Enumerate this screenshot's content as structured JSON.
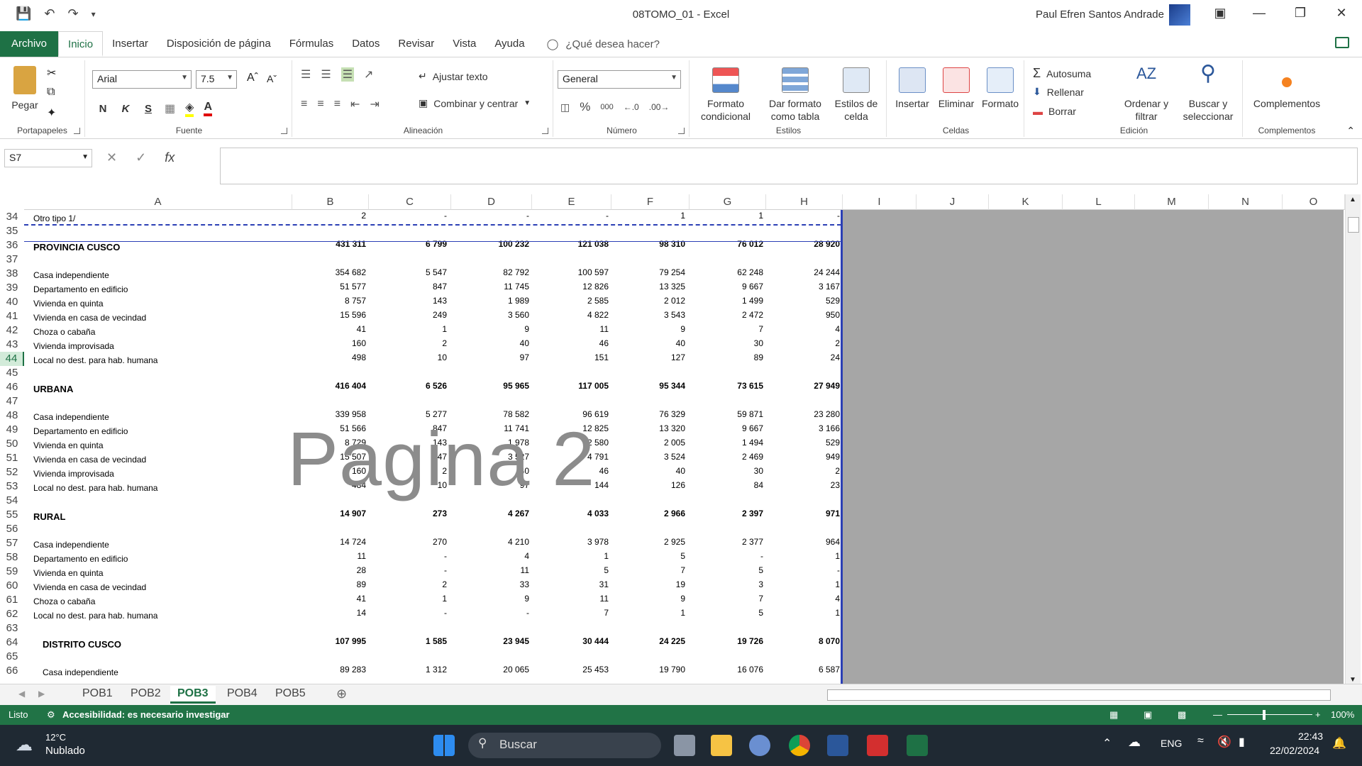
{
  "titlebar": {
    "title": "08TOMO_01  -  Excel",
    "user": "Paul Efren Santos Andrade"
  },
  "tabs": [
    "Archivo",
    "Inicio",
    "Insertar",
    "Disposición de página",
    "Fórmulas",
    "Datos",
    "Revisar",
    "Vista",
    "Ayuda"
  ],
  "tellme": "¿Qué desea hacer?",
  "ribbon": {
    "portapapeles": {
      "paste": "Pegar",
      "label": "Portapapeles"
    },
    "fuente": {
      "font": "Arial",
      "size": "7.5",
      "label": "Fuente",
      "bold": "N",
      "italic": "K",
      "underline": "S"
    },
    "alineacion": {
      "wrap": "Ajustar texto",
      "merge": "Combinar y centrar",
      "label": "Alineación"
    },
    "numero": {
      "format": "General",
      "label": "Número",
      "percent": "%",
      "thousands": "000"
    },
    "estilos": {
      "cond": "Formato condicional",
      "table": "Dar formato como tabla",
      "cell": "Estilos de celda",
      "label": "Estilos"
    },
    "celdas": {
      "insert": "Insertar",
      "delete": "Eliminar",
      "format": "Formato",
      "label": "Celdas"
    },
    "edicion": {
      "autosum": "Autosuma",
      "fill": "Rellenar",
      "clear": "Borrar",
      "sort": "Ordenar y filtrar",
      "find": "Buscar y seleccionar",
      "label": "Edición"
    },
    "complementos": {
      "addins": "Complementos",
      "label": "Complementos"
    }
  },
  "formula_bar": {
    "name_box": "S7",
    "fx": "fx",
    "value": ""
  },
  "columns": [
    "A",
    "B",
    "C",
    "D",
    "E",
    "F",
    "G",
    "H",
    "I",
    "J",
    "K",
    "L",
    "M",
    "N",
    "O"
  ],
  "row_numbers": [
    "34",
    "35",
    "36",
    "37",
    "38",
    "39",
    "40",
    "41",
    "42",
    "43",
    "44",
    "45",
    "46",
    "47",
    "48",
    "49",
    "50",
    "51",
    "52",
    "53",
    "54",
    "55",
    "56",
    "57",
    "58",
    "59",
    "60",
    "61",
    "62",
    "63",
    "64",
    "65",
    "66"
  ],
  "selected_row": "44",
  "rows": [
    {
      "label": "Otro tipo 1/",
      "style": "plain",
      "values": [
        "2",
        "-",
        "-",
        "-",
        "1",
        "1",
        "-"
      ]
    },
    {
      "label": "",
      "style": "blank",
      "values": []
    },
    {
      "label": "PROVINCIA CUSCO",
      "style": "bold",
      "values": [
        "431 311",
        "6 799",
        "100 232",
        "121 038",
        "98 310",
        "76 012",
        "28 920"
      ]
    },
    {
      "label": "",
      "style": "blank",
      "values": []
    },
    {
      "label": "Casa independiente",
      "style": "plain",
      "values": [
        "354 682",
        "5 547",
        "82 792",
        "100 597",
        "79 254",
        "62 248",
        "24 244"
      ]
    },
    {
      "label": "Departamento en edificio",
      "style": "plain",
      "values": [
        "51 577",
        "847",
        "11 745",
        "12 826",
        "13 325",
        "9 667",
        "3 167"
      ]
    },
    {
      "label": "Vivienda en quinta",
      "style": "plain",
      "values": [
        "8 757",
        "143",
        "1 989",
        "2 585",
        "2 012",
        "1 499",
        "529"
      ]
    },
    {
      "label": "Vivienda en casa de vecindad",
      "style": "plain",
      "values": [
        "15 596",
        "249",
        "3 560",
        "4 822",
        "3 543",
        "2 472",
        "950"
      ]
    },
    {
      "label": "Choza o cabaña",
      "style": "plain",
      "values": [
        "41",
        "1",
        "9",
        "11",
        "9",
        "7",
        "4"
      ]
    },
    {
      "label": "Vivienda improvisada",
      "style": "plain",
      "values": [
        "160",
        "2",
        "40",
        "46",
        "40",
        "30",
        "2"
      ]
    },
    {
      "label": "Local no dest. para hab. humana",
      "style": "plain",
      "values": [
        "498",
        "10",
        "97",
        "151",
        "127",
        "89",
        "24"
      ]
    },
    {
      "label": "",
      "style": "blank",
      "values": []
    },
    {
      "label": "URBANA",
      "style": "bold",
      "values": [
        "416 404",
        "6 526",
        "95 965",
        "117 005",
        "95 344",
        "73 615",
        "27 949"
      ]
    },
    {
      "label": "",
      "style": "blank",
      "values": []
    },
    {
      "label": "Casa independiente",
      "style": "plain",
      "values": [
        "339 958",
        "5 277",
        "78 582",
        "96 619",
        "76 329",
        "59 871",
        "23 280"
      ]
    },
    {
      "label": "Departamento en edificio",
      "style": "plain",
      "values": [
        "51 566",
        "847",
        "11 741",
        "12 825",
        "13 320",
        "9 667",
        "3 166"
      ]
    },
    {
      "label": "Vivienda en quinta",
      "style": "plain",
      "values": [
        "8 729",
        "143",
        "1 978",
        "2 580",
        "2 005",
        "1 494",
        "529"
      ]
    },
    {
      "label": "Vivienda en casa de vecindad",
      "style": "plain",
      "values": [
        "15 507",
        "247",
        "3 527",
        "4 791",
        "3 524",
        "2 469",
        "949"
      ]
    },
    {
      "label": "Vivienda improvisada",
      "style": "plain",
      "values": [
        "160",
        "2",
        "40",
        "46",
        "40",
        "30",
        "2"
      ]
    },
    {
      "label": "Local no dest. para hab. humana",
      "style": "plain",
      "values": [
        "484",
        "10",
        "97",
        "144",
        "126",
        "84",
        "23"
      ]
    },
    {
      "label": "",
      "style": "blank",
      "values": []
    },
    {
      "label": "RURAL",
      "style": "bold",
      "values": [
        "14 907",
        "273",
        "4 267",
        "4 033",
        "2 966",
        "2 397",
        "971"
      ]
    },
    {
      "label": "",
      "style": "blank",
      "values": []
    },
    {
      "label": "Casa independiente",
      "style": "plain",
      "values": [
        "14 724",
        "270",
        "4 210",
        "3 978",
        "2 925",
        "2 377",
        "964"
      ]
    },
    {
      "label": "Departamento en edificio",
      "style": "plain",
      "values": [
        "11",
        "-",
        "4",
        "1",
        "5",
        "-",
        "1"
      ]
    },
    {
      "label": "Vivienda en quinta",
      "style": "plain",
      "values": [
        "28",
        "-",
        "11",
        "5",
        "7",
        "5",
        "-"
      ]
    },
    {
      "label": "Vivienda en casa de vecindad",
      "style": "plain",
      "values": [
        "89",
        "2",
        "33",
        "31",
        "19",
        "3",
        "1"
      ]
    },
    {
      "label": "Choza o cabaña",
      "style": "plain",
      "values": [
        "41",
        "1",
        "9",
        "11",
        "9",
        "7",
        "4"
      ]
    },
    {
      "label": "Local no dest. para hab. humana",
      "style": "plain",
      "values": [
        "14",
        "-",
        "-",
        "7",
        "1",
        "5",
        "1"
      ]
    },
    {
      "label": "",
      "style": "blank",
      "values": []
    },
    {
      "label": "DISTRITO CUSCO",
      "style": "bold-indent",
      "values": [
        "107 995",
        "1 585",
        "23 945",
        "30 444",
        "24 225",
        "19 726",
        "8 070"
      ]
    },
    {
      "label": "",
      "style": "blank",
      "values": []
    },
    {
      "label": "Casa independiente",
      "style": "plain-indent",
      "values": [
        "89 283",
        "1 312",
        "20 065",
        "25 453",
        "19 790",
        "16 076",
        "6 587"
      ]
    }
  ],
  "watermark": "Pagina 2",
  "sheets": [
    "POB1",
    "POB2",
    "POB3",
    "POB4",
    "POB5"
  ],
  "active_sheet": "POB3",
  "status": {
    "ready": "Listo",
    "accessibility": "Accesibilidad: es necesario investigar",
    "zoom": "100%"
  },
  "taskbar": {
    "weather_temp": "12°C",
    "weather_desc": "Nublado",
    "search": "Buscar",
    "lang": "ENG",
    "time": "22:43",
    "date": "22/02/2024"
  },
  "colors": {
    "excel_green": "#217346",
    "page_border": "#2b3fb5",
    "outside_print": "#a6a6a6"
  }
}
